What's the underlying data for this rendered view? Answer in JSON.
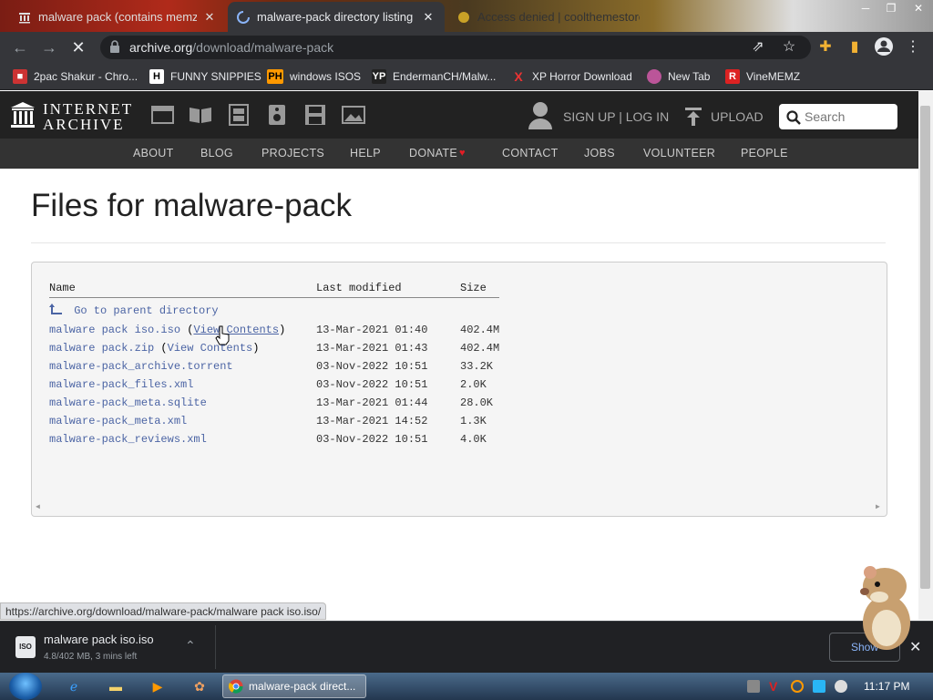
{
  "browser": {
    "tabs": [
      {
        "title": "malware pack (contains memz) -",
        "active": false
      },
      {
        "title": "malware-pack directory listing",
        "active": true
      },
      {
        "title": "Access denied | coolthemestore",
        "active": false
      }
    ],
    "url_domain": "archive.org",
    "url_path": "/download/malware-pack",
    "bookmarks": [
      {
        "label": "2pac Shakur - Chro...",
        "icon": "2pac-icon"
      },
      {
        "label": "FUNNY SNIPPIES",
        "icon_text": "H",
        "icon": "h-icon"
      },
      {
        "label": "windows ISOS",
        "icon_text": "PH",
        "icon": "ph-icon"
      },
      {
        "label": "EndermanCH/Malw...",
        "icon_text": "YP",
        "icon": "yp-icon"
      },
      {
        "label": "XP Horror Download",
        "icon_text": "X",
        "icon": "x-icon"
      },
      {
        "label": "New Tab",
        "icon": "newtab-icon"
      },
      {
        "label": "VineMEMZ",
        "icon_text": "R",
        "icon": "r-icon"
      }
    ]
  },
  "ia": {
    "logo_line1": "INTERNET",
    "logo_line2": "ARCHIVE",
    "signup": "SIGN UP | LOG IN",
    "upload": "UPLOAD",
    "search_placeholder": "Search",
    "nav": [
      "ABOUT",
      "BLOG",
      "PROJECTS",
      "HELP",
      "DONATE",
      "CONTACT",
      "JOBS",
      "VOLUNTEER",
      "PEOPLE"
    ],
    "donate_heart": "♥"
  },
  "page": {
    "title": "Files for malware-pack",
    "headers": {
      "name": "Name",
      "modified": "Last modified",
      "size": "Size"
    },
    "parent": "Go to parent directory",
    "files": [
      {
        "name": "malware pack iso.iso",
        "extra_open": " (",
        "extra_link": "View Contents",
        "extra_close": ")",
        "date": "13-Mar-2021 01:40",
        "size": "402.4M"
      },
      {
        "name": "malware pack.zip",
        "extra_open": " (",
        "extra_link": "View Contents",
        "extra_close": ")",
        "date": "13-Mar-2021 01:43",
        "size": "402.4M"
      },
      {
        "name": "malware-pack_archive.torrent",
        "date": "03-Nov-2022 10:51",
        "size": "33.2K"
      },
      {
        "name": "malware-pack_files.xml",
        "date": "03-Nov-2022 10:51",
        "size": "2.0K"
      },
      {
        "name": "malware-pack_meta.sqlite",
        "date": "13-Mar-2021 01:44",
        "size": "28.0K"
      },
      {
        "name": "malware-pack_meta.xml",
        "date": "13-Mar-2021 14:52",
        "size": "1.3K"
      },
      {
        "name": "malware-pack_reviews.xml",
        "date": "03-Nov-2022 10:51",
        "size": "4.0K"
      }
    ]
  },
  "status_url": "https://archive.org/download/malware-pack/malware pack iso.iso/",
  "download": {
    "filename": "malware pack iso.iso",
    "progress": "4.8/402 MB, 3 mins left",
    "icon_label": "ISO",
    "show_all": "Show"
  },
  "taskbar": {
    "chrome_label": "malware-pack direct...",
    "clock": "11:17 PM"
  }
}
